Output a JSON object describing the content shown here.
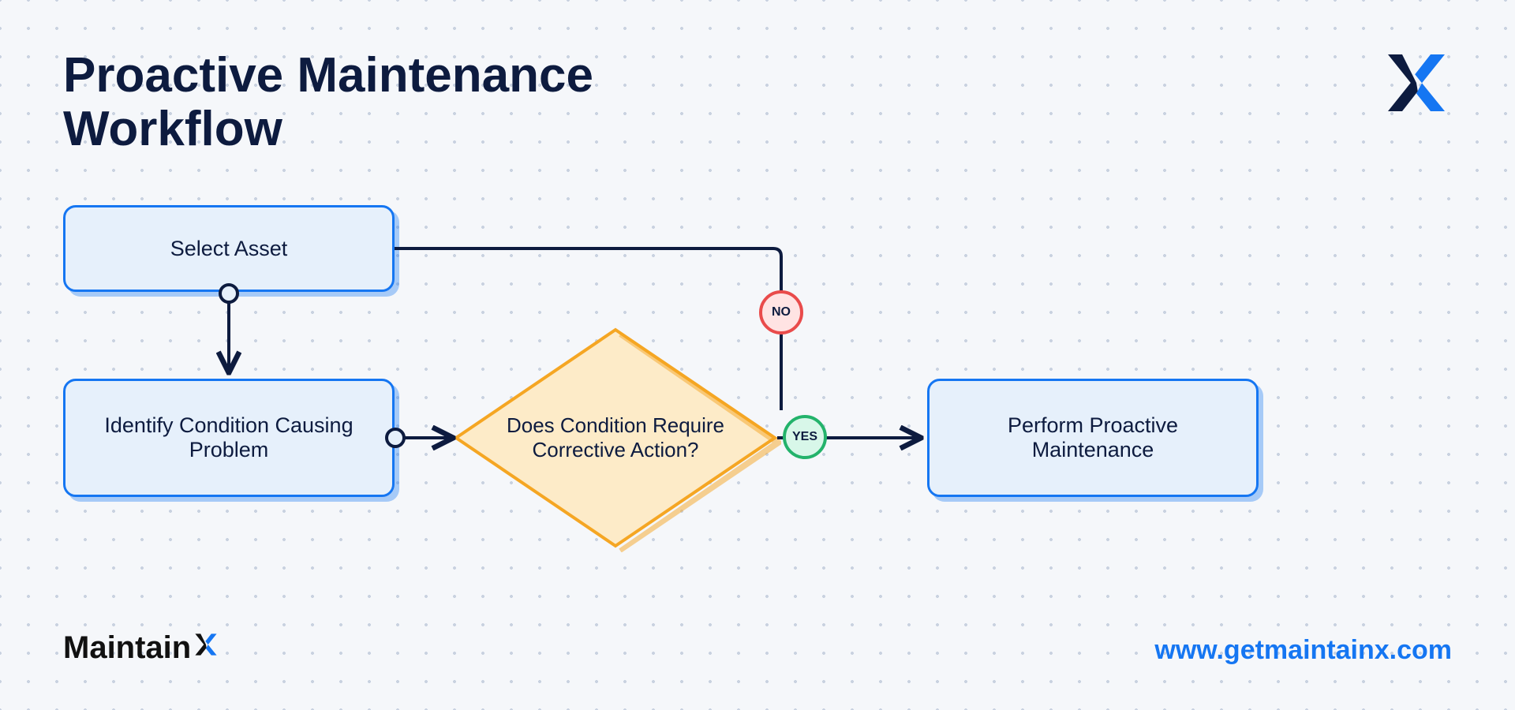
{
  "title": "Proactive Maintenance Workflow",
  "nodes": {
    "select_asset": "Select Asset",
    "identify": "Identify Condition Causing Problem",
    "decision": "Does Condition Require Corrective Action?",
    "perform": "Perform Proactive Maintenance"
  },
  "badges": {
    "no": "NO",
    "yes": "YES"
  },
  "footer": {
    "brand_prefix": "Maintain",
    "url": "www.getmaintainx.com"
  },
  "colors": {
    "primary_blue": "#1576f2",
    "navy": "#0d1b3f",
    "box_fill": "#e6f0fb",
    "diamond_stroke": "#f5a623",
    "diamond_fill": "#fdebc8",
    "no_stroke": "#e94b4b",
    "yes_stroke": "#23b36b"
  }
}
